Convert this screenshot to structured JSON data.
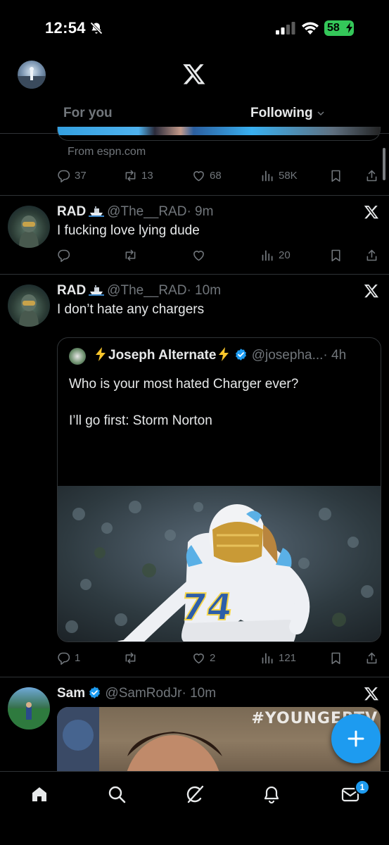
{
  "status_bar": {
    "time": "12:54",
    "battery": "58"
  },
  "tabs": {
    "for_you": "For you",
    "following": "Following"
  },
  "previous_tweet": {
    "source": "From espn.com",
    "replies": "37",
    "reposts": "13",
    "likes": "68",
    "views": "58K"
  },
  "tweets": [
    {
      "name": "RAD",
      "handle": "@The__RAD",
      "time": "· 9m",
      "text": "I fucking love lying dude",
      "replies": "",
      "reposts": "",
      "likes": "",
      "views": "20"
    },
    {
      "name": "RAD",
      "handle": "@The__RAD",
      "time": "· 10m",
      "text": "I don’t hate any chargers",
      "replies": "1",
      "reposts": "",
      "likes": "2",
      "views": "121",
      "quote": {
        "name": "Joseph Alternate",
        "handle": "@josepha...",
        "time": "· 4h",
        "line1": "Who is your most hated Charger ever?",
        "line2": "I’ll go first: Storm Norton",
        "jersey_number": "74"
      }
    },
    {
      "name": "Sam",
      "handle": "@SamRodJr",
      "time": "· 10m",
      "image_watermark": "#YOUNGERTV"
    }
  ],
  "nav": {
    "messages_badge": "1"
  },
  "colors": {
    "accent": "#1d9bf0",
    "muted": "#71767b",
    "divider": "#2f3336",
    "battery": "#34c759"
  },
  "icons": [
    "bell-slash-icon",
    "signal-icon",
    "wifi-icon",
    "x-logo-icon",
    "reply-icon",
    "repost-icon",
    "like-icon",
    "views-icon",
    "bookmark-icon",
    "share-icon",
    "verified-icon",
    "lightning-icon",
    "home-icon",
    "search-icon",
    "grok-icon",
    "bell-icon",
    "mail-icon",
    "plus-icon"
  ]
}
